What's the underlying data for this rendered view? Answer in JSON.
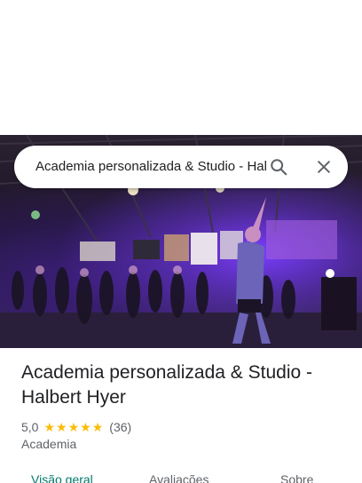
{
  "hero": {
    "image_description": "",
    "image": "gym-dance-class-photo"
  },
  "search": {
    "query": "Academia personalizada & Studio - Halbert Hyer",
    "search_icon": "search-icon",
    "close_icon": "close-icon"
  },
  "place": {
    "name": "Academia personalizada & Studio - Halbert Hyer",
    "rating": "5,0",
    "stars": 5,
    "reviews_count": "(36)",
    "category": "Academia"
  },
  "tabs": [
    {
      "label": "Visão geral",
      "active": true
    },
    {
      "label": "Avaliações",
      "active": false
    },
    {
      "label": "Sobre",
      "active": false
    }
  ],
  "colors": {
    "star": "#fbbc04",
    "active_tab": "#00796b",
    "secondary_text": "#5f6368"
  }
}
